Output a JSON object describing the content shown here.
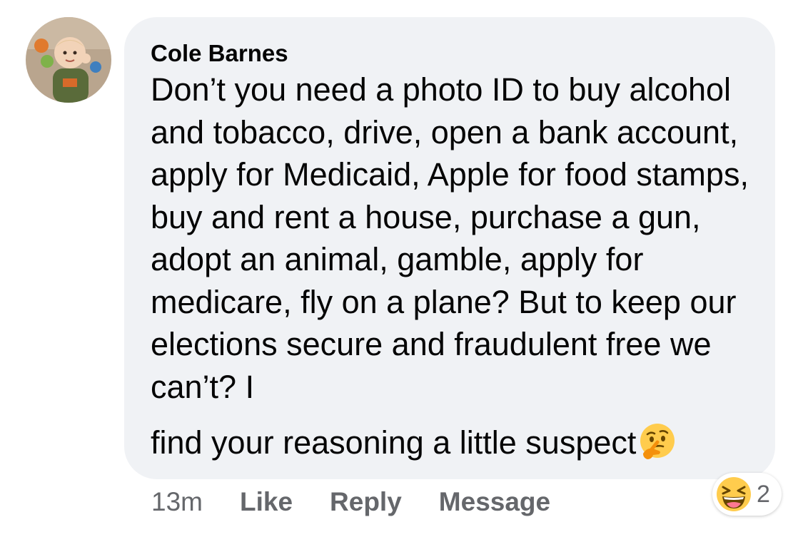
{
  "comment": {
    "author": "Cole Barnes",
    "text": "Don’t you need a photo ID to buy alcohol and tobacco, drive, open a bank account, apply for Medicaid, Apple for food stamps, buy and rent a house, purchase a gun, adopt an animal, gamble, apply for medicare, fly on a plane? But to keep our elections secure and fraudulent free we can’t? I",
    "text_last_line": "find your reasoning a little suspect",
    "inline_emoji": "thinking-face-icon"
  },
  "actions": {
    "timestamp": "13m",
    "like_label": "Like",
    "reply_label": "Reply",
    "message_label": "Message"
  },
  "reactions": {
    "icon": "laughing-face-icon",
    "count": "2"
  },
  "colors": {
    "bubble_bg": "#f0f2f5",
    "meta_text": "#65676b",
    "body_text": "#050505"
  }
}
